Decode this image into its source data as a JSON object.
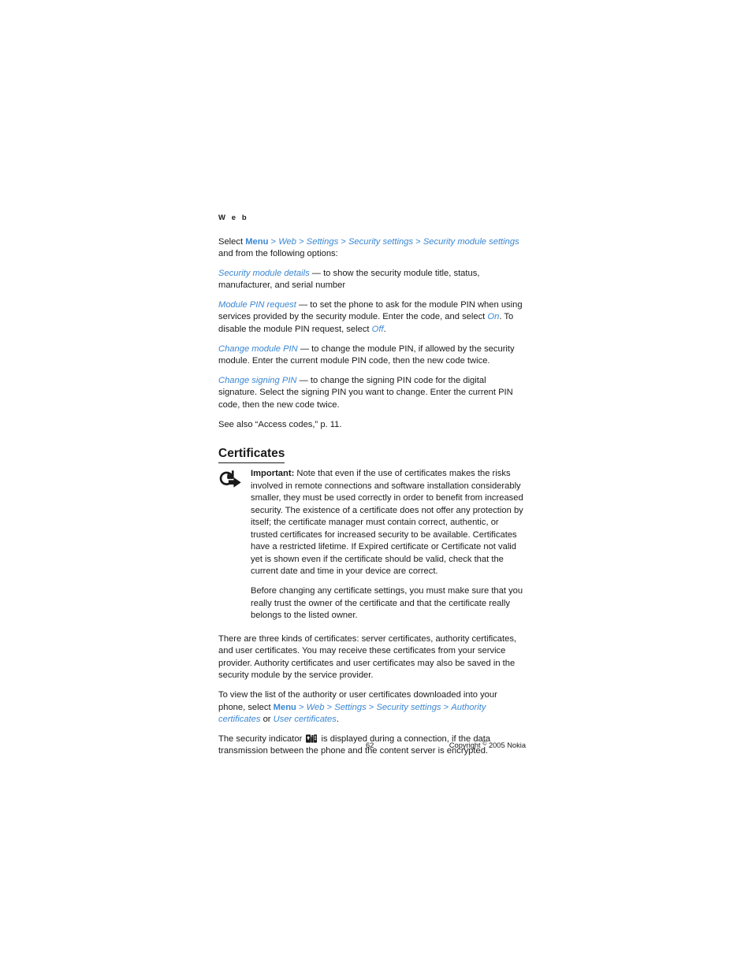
{
  "running_header": "W e b",
  "body": {
    "intro": {
      "prefix": "Select ",
      "path": [
        "Menu",
        "Web",
        "Settings",
        "Security settings",
        "Security module settings"
      ],
      "separator": ">",
      "suffix": "and from the following options:"
    },
    "options": [
      {
        "term": "Security module details",
        "dash": "—",
        "desc": "to show the security module title, status, manufacturer, and serial number"
      },
      {
        "term": "Module PIN request",
        "dash": "—",
        "desc_part1": "to set the phone to ask for the module PIN when using services provided by the security module. Enter the code, and select ",
        "value_on": "On",
        "desc_part2": ". To disable the module PIN request, select ",
        "value_off": "Off",
        "desc_part3": "."
      },
      {
        "term": "Change module PIN",
        "dash": "—",
        "desc": "to change the module PIN, if allowed by the security module. Enter the current module PIN code, then the new code twice."
      },
      {
        "term": "Change signing PIN",
        "dash": "—",
        "desc": "to change the signing PIN code for the digital signature. Select the signing PIN you want to change. Enter the current PIN code, then the new code twice."
      }
    ],
    "see_also": "See also “Access codes,” p. 11."
  },
  "certificates": {
    "heading": "Certificates",
    "note_icon_name": "important-note-icon",
    "important_label": "Important:",
    "important_text": " Note that even if the use of certificates makes the risks involved in remote connections and software installation considerably smaller, they must be used correctly in order to benefit from increased security. The existence of a certificate does not offer any protection by itself; the certificate manager must contain correct, authentic, or trusted certificates for increased security to be available. Certificates have a restricted lifetime. If Expired certificate or Certificate not valid yet is shown even if the certificate should be valid, check that the current date and time in your device are correct.",
    "note_second_para": "Before changing any certificate settings, you must make sure that you really trust the owner of the certificate and that the certificate really belongs to the listed owner.",
    "kinds_para": "There are three kinds of certificates: server certificates, authority certificates, and user certificates. You may receive these certificates from your service provider. Authority certificates and user certificates may also be saved in the security module by the service provider.",
    "view_list": {
      "prefix": "To view the list of the authority or user certificates downloaded into your phone, select ",
      "path": [
        "Menu",
        "Web",
        "Settings",
        "Security settings",
        "Authority certificates"
      ],
      "separator": ">",
      "conjunction": " or ",
      "last_link": "User certificates",
      "period": "."
    },
    "security_indicator": {
      "prefix": "The security indicator ",
      "icon_name": "security-padlock-indicator-icon",
      "suffix": " is displayed during a connection, if the data transmission between the phone and the content server is encrypted."
    }
  },
  "footer": {
    "page_number": "62",
    "copyright_prefix": "Copyright ",
    "copyright_symbol": "©",
    "copyright_suffix": " 2005 Nokia"
  },
  "colors": {
    "link_blue": "#3a87d4",
    "text_black": "#1a1a1a",
    "page_background": "#ffffff"
  }
}
